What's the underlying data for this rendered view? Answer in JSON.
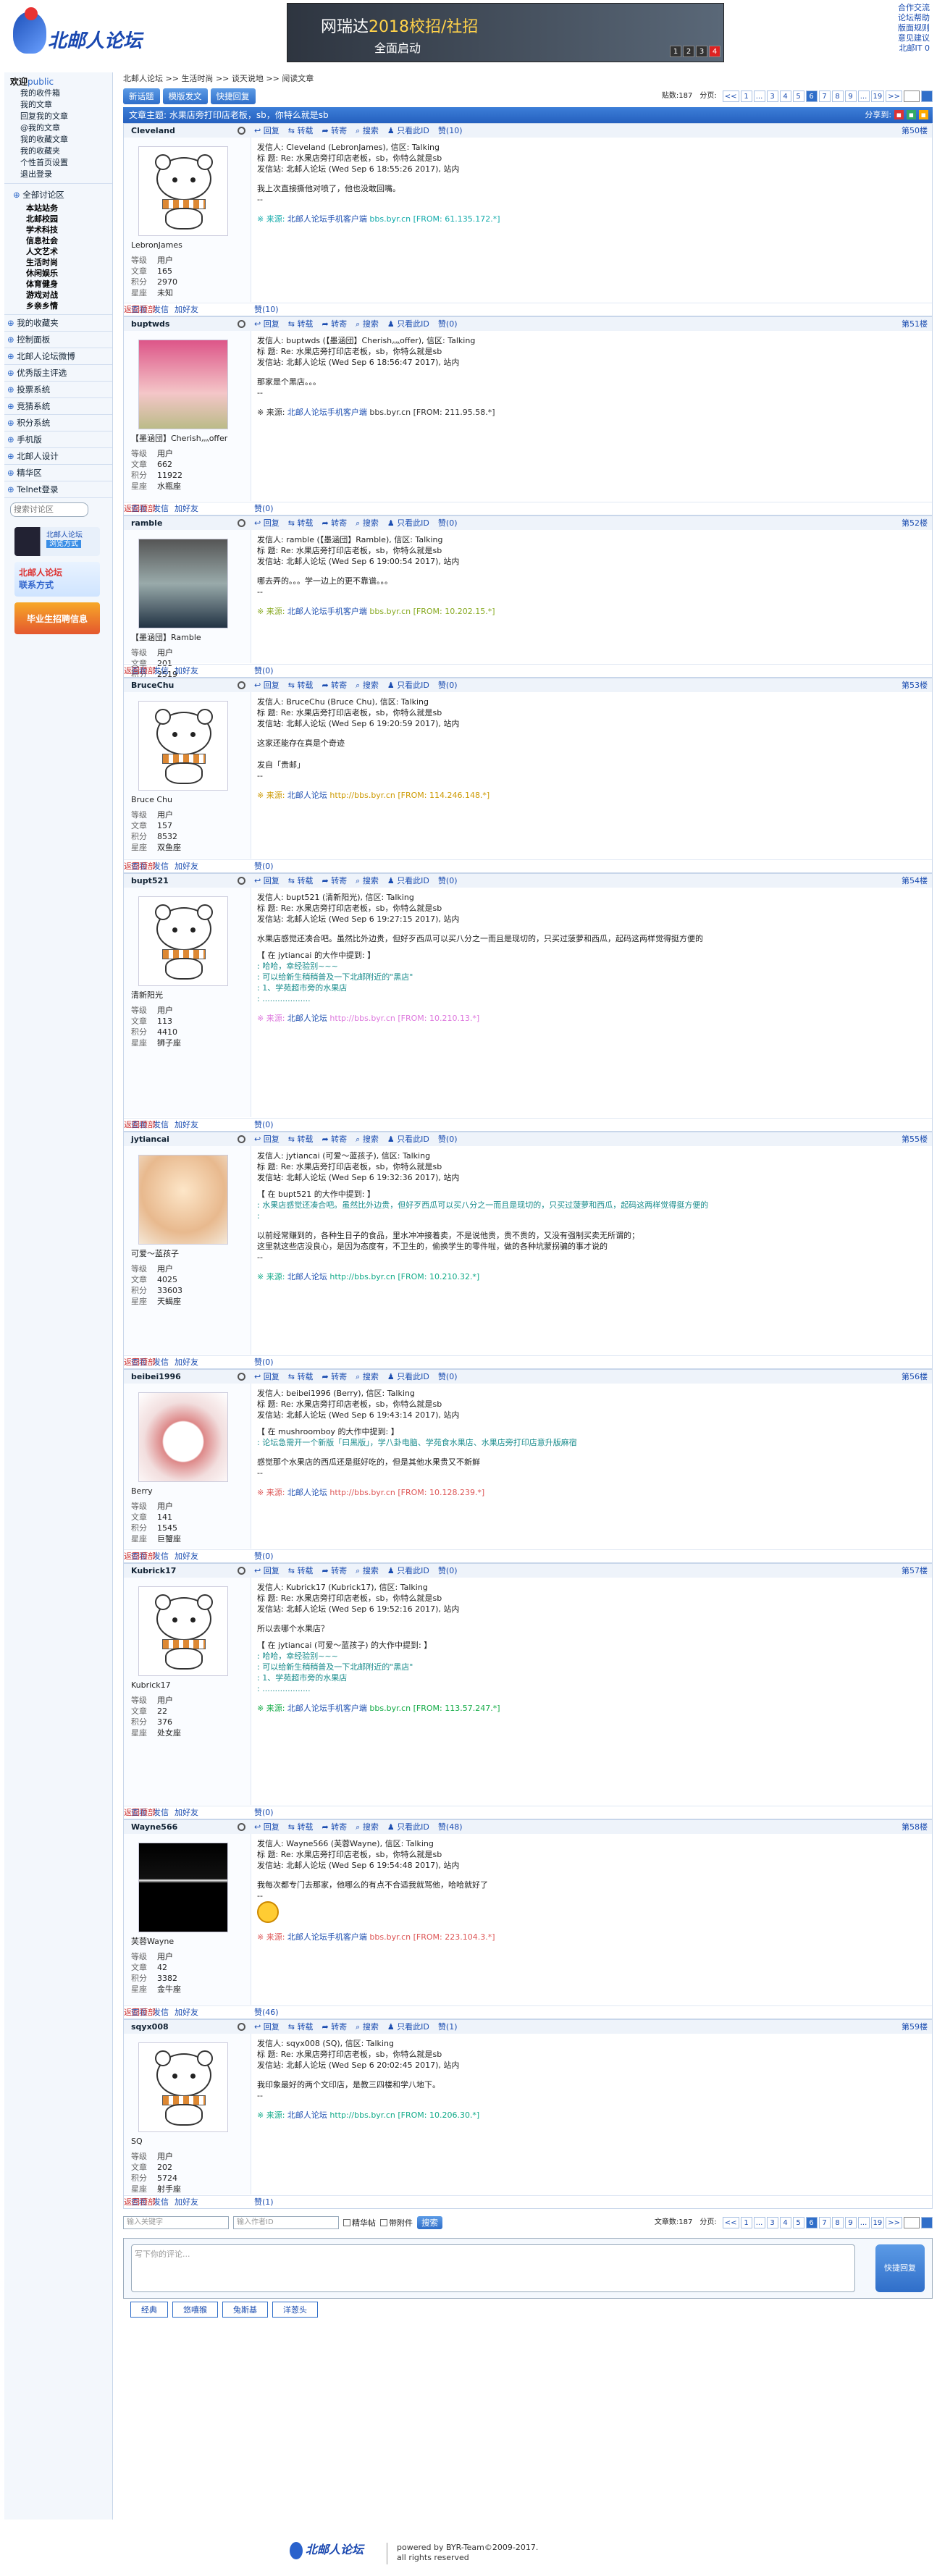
{
  "header": {
    "logo_text": "北邮人论坛",
    "banner_title_a": "网瑞达",
    "banner_title_b": "2018校招/社招",
    "banner_sub": "全面启动",
    "banner_nums": [
      "1",
      "2",
      "3",
      "4"
    ],
    "links": [
      "合作交流",
      "论坛帮助",
      "版面规则",
      "意见建议",
      "北邮IT 0"
    ]
  },
  "sidebar": {
    "welcome": "欢迎",
    "user": "public",
    "user_links": [
      "我的收件箱",
      "我的文章",
      "回复我的文章",
      "@我的文章",
      "我的收藏文章",
      "我的收藏夹",
      "个性首页设置",
      "退出登录"
    ],
    "all_boards": "全部讨论区",
    "boards": [
      "本站站务",
      "北邮校园",
      "学术科技",
      "信息社会",
      "人文艺术",
      "生活时尚",
      "休闲娱乐",
      "体育健身",
      "游戏对战",
      "乡亲乡情"
    ],
    "sections": [
      "我的收藏夹",
      "控制面板",
      "北邮人论坛微博",
      "优秀版主评选",
      "投票系统",
      "竞猜系统",
      "积分系统",
      "手机版",
      "北邮人设计",
      "精华区",
      "Telnet登录"
    ],
    "search_placeholder": "搜索讨论区",
    "ad1": "北邮人论坛",
    "ad1b": "浏览方式",
    "ad2": "毕业生招聘信息"
  },
  "main": {
    "breadcrumb": [
      "北邮人论坛",
      ">>",
      "生活时尚",
      ">>",
      "谈天说地",
      ">>",
      "阅读文章"
    ],
    "btn_new": "新话题",
    "btn_mode": "模版发文",
    "btn_quick": "快捷回复",
    "post_count_label": "贴数:187",
    "page_label": "分页:",
    "pages": [
      "<<",
      "1",
      "...",
      "3",
      "4",
      "5",
      "6",
      "7",
      "8",
      "9",
      "...",
      "19",
      ">>"
    ],
    "current_page": "6",
    "title_prefix": "文章主题:",
    "title": "水果店旁打印店老板，sb，你特么就是sb",
    "share": "分享到:"
  },
  "post_actions": {
    "reply": "回复",
    "forward": "转载",
    "transfer": "转寄",
    "search": "搜索",
    "only_author": "只看此ID",
    "view": "查看",
    "msg": "发信",
    "add": "加好友",
    "top": "返回顶部"
  },
  "labels": {
    "level": "等级",
    "posts": "文章",
    "score": "积分",
    "star": "星座"
  },
  "posts": [
    {
      "id": "Cleveland",
      "nick": "LebronJames",
      "level": "用户",
      "posts": "165",
      "score": "2970",
      "star": "未知",
      "floor": "第50楼",
      "praise": "赞(10)",
      "like": "赞(10)",
      "meta": [
        "发信人: Cleveland (LebronJames), 信区: Talking",
        "标  题: Re: 水果店旁打印店老板，sb，你特么就是sb",
        "发信站: 北邮人论坛 (Wed Sep  6 18:55:26 2017), 站内"
      ],
      "content": [
        "我上次直接撕他对喷了，他也没敢回嘴。",
        "--"
      ],
      "src_prefix": "※ 来源:",
      "src_link": "北邮人论坛手机客户端",
      "src_domain": "bbs.byr.cn",
      "src_ip": "[FROM: 61.135.172.*]",
      "src_color": "#1aa"
    },
    {
      "id": "buptwds",
      "nick": "【墨涵団】Cherish灬offer",
      "level": "用户",
      "posts": "662",
      "score": "11922",
      "star": "水瓶座",
      "floor": "第51楼",
      "praise": "赞(0)",
      "like": "赞(0)",
      "meta": [
        "发信人: buptwds (【墨涵団】Cherish灬offer), 信区: Talking",
        "标  题: Re: 水果店旁打印店老板，sb，你特么就是sb",
        "发信站: 北邮人论坛 (Wed Sep  6 18:56:47 2017), 站内"
      ],
      "content": [
        "那家是个黑店。。。",
        "--"
      ],
      "src_prefix": "※ 来源:",
      "src_link": "北邮人论坛手机客户端",
      "src_domain": "bbs.byr.cn",
      "src_ip": "[FROM: 211.95.58.*]",
      "src_color": "#333"
    },
    {
      "id": "ramble",
      "nick": "【墨涵団】Ramble",
      "level": "用户",
      "posts": "201",
      "score": "2519",
      "star": "未知",
      "floor": "第52楼",
      "praise": "赞(0)",
      "like": "赞(0)",
      "meta": [
        "发信人: ramble (【墨涵団】Ramble), 信区: Talking",
        "标  题: Re: 水果店旁打印店老板，sb，你特么就是sb",
        "发信站: 北邮人论坛 (Wed Sep  6 19:00:54 2017), 站内"
      ],
      "content": [
        "哪去弄的。。。学一边上的更不靠谱。。。",
        "--"
      ],
      "src_prefix": "※ 来源:",
      "src_link": "北邮人论坛手机客户端",
      "src_domain": "bbs.byr.cn",
      "src_ip": "[FROM: 10.202.15.*]",
      "src_color": "#8a2"
    },
    {
      "id": "BruceChu",
      "nick": "Bruce Chu",
      "level": "用户",
      "posts": "157",
      "score": "8532",
      "star": "双鱼座",
      "floor": "第53楼",
      "praise": "赞(0)",
      "like": "赞(0)",
      "meta": [
        "发信人: BruceChu (Bruce Chu), 信区: Talking",
        "标  题: Re: 水果店旁打印店老板，sb，你特么就是sb",
        "发信站: 北邮人论坛 (Wed Sep  6 19:20:59 2017), 站内"
      ],
      "content": [
        "这家还能存在真是个奇迹",
        "",
        "发自「贵邮」",
        "--"
      ],
      "src_prefix": "※ 来源:",
      "src_link": "北邮人论坛",
      "src_domain": "http://bbs.byr.cn",
      "src_ip": "[FROM: 114.246.148.*]",
      "src_color": "#c90"
    },
    {
      "id": "bupt521",
      "nick": "清新阳光",
      "level": "用户",
      "posts": "113",
      "score": "4410",
      "star": "狮子座",
      "floor": "第54楼",
      "praise": "赞(0)",
      "like": "赞(0)",
      "meta": [
        "发信人: bupt521 (清新阳光), 信区: Talking",
        "标  题: Re: 水果店旁打印店老板，sb，你特么就是sb",
        "发信站: 北邮人论坛 (Wed Sep  6 19:27:15 2017), 站内"
      ],
      "content": [
        "水果店感觉还凑合吧。虽然比外边贵，但好歹西瓜可以买八分之一而且是现切的，只买过菠萝和西瓜，起码这两样觉得挺方便的"
      ],
      "quote_head": "【 在 jytiancai 的大作中提到: 】",
      "quote": [
        ": 哈哈，幸经验别~~~",
        ": 可以给新生稍稍普及一下北邮附近的\"黑店\"",
        ": 1、学苑超市旁的水果店",
        ": ..................."
      ],
      "src_prefix": "※ 来源:",
      "src_link": "北邮人论坛",
      "src_domain": "http://bbs.byr.cn",
      "src_ip": "[FROM: 10.210.13.*]",
      "src_color": "#d7d"
    },
    {
      "id": "jytiancai",
      "nick": "可爱～蓝孩子",
      "level": "用户",
      "posts": "4025",
      "score": "33603",
      "star": "天蝎座",
      "floor": "第55楼",
      "praise": "赞(0)",
      "like": "赞(0)",
      "meta": [
        "发信人: jytiancai (可爱～蓝孩子), 信区: Talking",
        "标  题: Re: 水果店旁打印店老板，sb，你特么就是sb",
        "发信站: 北邮人论坛 (Wed Sep  6 19:32:36 2017), 站内"
      ],
      "quote_head": "【 在 bupt521 的大作中提到: 】",
      "quote": [
        ": 水果店感觉还凑合吧。虽然比外边贵，但好歹西瓜可以买八分之一而且是现切的，只买过菠萝和西瓜，起码这两样觉得挺方便的",
        ":"
      ],
      "content": [
        "以前经常赚到的，各种生日子的食品，里水冲冲接着卖，不是说他贵，贵不贵的，又没有强制买卖无所谓的；",
        "这里就这些店没良心，是因为态度有，不卫生的，偷换学生的零件啦，做的各种坑蒙拐骗的事才说的",
        "--"
      ],
      "src_prefix": "※ 来源:",
      "src_link": "北邮人论坛",
      "src_domain": "http://bbs.byr.cn",
      "src_ip": "[FROM: 10.210.32.*]",
      "src_color": "#1a8"
    },
    {
      "id": "beibei1996",
      "nick": "Berry",
      "level": "用户",
      "posts": "141",
      "score": "1545",
      "star": "巨蟹座",
      "floor": "第56楼",
      "praise": "赞(0)",
      "like": "赞(0)",
      "meta": [
        "发信人: beibei1996 (Berry), 信区: Talking",
        "标  题: Re: 水果店旁打印店老板，sb，你特么就是sb",
        "发信站: 北邮人论坛 (Wed Sep  6 19:43:14 2017), 站内"
      ],
      "quote_head": "【 在 mushroomboy 的大作中提到: 】",
      "quote": [
        ": 论坛急需开一个新版「曰黑版」，学八卦电脑、学苑食水果店、水果店旁打印店意升版麻宿"
      ],
      "content": [
        "感觉那个水果店的西瓜还是挺好吃的，但是其他水果贵又不新鲜",
        "--"
      ],
      "src_prefix": "※ 来源:",
      "src_link": "北邮人论坛",
      "src_domain": "http://bbs.byr.cn",
      "src_ip": "[FROM: 10.128.239.*]",
      "src_color": "#d55"
    },
    {
      "id": "Kubrick17",
      "nick": "Kubrick17",
      "level": "用户",
      "posts": "22",
      "score": "376",
      "star": "处女座",
      "floor": "第57楼",
      "praise": "赞(0)",
      "like": "赞(0)",
      "meta": [
        "发信人: Kubrick17 (Kubrick17), 信区: Talking",
        "标  题: Re: 水果店旁打印店老板，sb，你特么就是sb",
        "发信站: 北邮人论坛 (Wed Sep  6 19:52:16 2017), 站内"
      ],
      "content": [
        "所以去哪个水果店？"
      ],
      "quote_head": "【 在 jytiancai (可爱～蓝孩子) 的大作中提到: 】",
      "quote": [
        ": 哈哈，幸经验别~~~",
        ": 可以给新生稍稍普及一下北邮附近的\"黑店\"",
        ": 1、学苑超市旁的水果店",
        ": ..................."
      ],
      "src_prefix": "※ 来源:",
      "src_link": "北邮人论坛手机客户端",
      "src_domain": "bbs.byr.cn",
      "src_ip": "[FROM: 113.57.247.*]",
      "src_color": "#1a4"
    },
    {
      "id": "Wayne566",
      "nick": "芙蓉Wayne",
      "level": "用户",
      "posts": "42",
      "score": "3382",
      "star": "金牛座",
      "floor": "第58楼",
      "praise": "赞(48)",
      "like": "赞(46)",
      "meta": [
        "发信人: Wayne566 (芙蓉Wayne), 信区: Talking",
        "标  题: Re: 水果店旁打印店老板，sb，你特么就是sb",
        "发信站: 北邮人论坛 (Wed Sep  6 19:54:48 2017), 站内"
      ],
      "content": [
        "我每次都专门去那家，他哪么的有点不合适我就骂他，哈哈就好了",
        "--"
      ],
      "src_prefix": "※ 来源:",
      "src_link": "北邮人论坛手机客户端",
      "src_domain": "bbs.byr.cn",
      "src_ip": "[FROM: 223.104.3.*]",
      "src_color": "#d55"
    },
    {
      "id": "sqyx008",
      "nick": "SQ",
      "level": "用户",
      "posts": "202",
      "score": "5724",
      "star": "射手座",
      "floor": "第59楼",
      "praise": "赞(1)",
      "like": "赞(1)",
      "meta": [
        "发信人: sqyx008 (SQ), 信区: Talking",
        "标  题: Re: 水果店旁打印店老板，sb，你特么就是sb",
        "发信站: 北邮人论坛 (Wed Sep  6 20:02:45 2017), 站内"
      ],
      "content": [
        "我印象最好的两个文印店，是教三四楼和学八地下。",
        "--"
      ],
      "src_prefix": "※ 来源:",
      "src_link": "北邮人论坛",
      "src_domain": "http://bbs.byr.cn",
      "src_ip": "[FROM: 10.206.30.*]",
      "src_color": "#1a8"
    }
  ],
  "bottom": {
    "user_placeholder": "输入关键字",
    "id_placeholder": "输入作者ID",
    "chk1": "精华帖",
    "chk2": "带附件",
    "search_btn": "搜索",
    "count_label": "文章数:187",
    "reply_placeholder": "写下你的评论...",
    "quick_reply": "快捷回复",
    "tabs": [
      "经典",
      "悠嘻猴",
      "兔斯基",
      "洋葱头"
    ]
  },
  "footer": {
    "logo": "北邮人论坛",
    "line1": "powered by BYR-Team©2009-2017.",
    "line2": "all rights reserved"
  }
}
